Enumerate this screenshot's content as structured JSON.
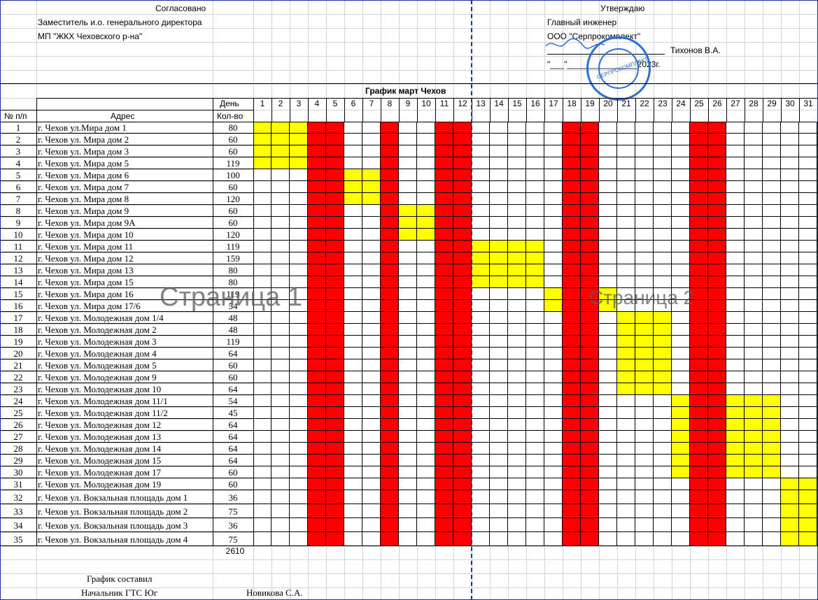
{
  "header": {
    "agreed_title": "Согласовано",
    "agreed_position": "Заместитель и.о. генерального директора",
    "agreed_org": "МП \"ЖКХ Чеховского р-на\"",
    "approve_title": "Утверждаю",
    "approve_position": "Главный инженер",
    "approve_org": "ООО \"Серпрокомплект\"",
    "approve_name": "Тихонов В.А.",
    "approve_date": "\"___\"_______________2023г.",
    "stamp_text": "СЕРПРОКОМПЛЕКТ"
  },
  "schedule_title": "График март Чехов",
  "columns": {
    "num": "№ п/п",
    "address": "Адрес",
    "day": "День",
    "qty": "Кол-во"
  },
  "days": [
    "1",
    "2",
    "3",
    "4",
    "5",
    "6",
    "7",
    "8",
    "9",
    "10",
    "11",
    "12",
    "13",
    "14",
    "15",
    "16",
    "17",
    "18",
    "19",
    "20",
    "21",
    "22",
    "23",
    "24",
    "25",
    "26",
    "27",
    "28",
    "29",
    "30",
    "31"
  ],
  "red_days": [
    4,
    5,
    8,
    11,
    12,
    18,
    19,
    25,
    26
  ],
  "rows": [
    {
      "n": "1",
      "addr": "г. Чехов ул.Мира дом 1",
      "qty": "80",
      "yellow": [
        1,
        2,
        3
      ]
    },
    {
      "n": "2",
      "addr": "г. Чехов ул. Мира дом 2",
      "qty": "60",
      "yellow": [
        1,
        2,
        3
      ]
    },
    {
      "n": "3",
      "addr": "г. Чехов ул. Мира дом 3",
      "qty": "60",
      "yellow": [
        1,
        2,
        3
      ]
    },
    {
      "n": "4",
      "addr": "г. Чехов ул. Мира дом 5",
      "qty": "119",
      "yellow": [
        1,
        2,
        3
      ]
    },
    {
      "n": "5",
      "addr": "г. Чехов ул. Мира дом 6",
      "qty": "100",
      "yellow": [
        6,
        7
      ]
    },
    {
      "n": "6",
      "addr": "г. Чехов ул. Мира дом 7",
      "qty": "60",
      "yellow": [
        6,
        7
      ]
    },
    {
      "n": "7",
      "addr": "г. Чехов ул. Мира дом 8",
      "qty": "120",
      "yellow": [
        6,
        7
      ]
    },
    {
      "n": "8",
      "addr": "г. Чехов ул. Мира дом 9",
      "qty": "60",
      "yellow": [
        9,
        10
      ]
    },
    {
      "n": "9",
      "addr": "г. Чехов ул. Мира дом 9А",
      "qty": "60",
      "yellow": [
        9,
        10
      ]
    },
    {
      "n": "10",
      "addr": "г. Чехов ул. Мира дом 10",
      "qty": "120",
      "yellow": [
        9,
        10
      ]
    },
    {
      "n": "11",
      "addr": "г. Чехов ул. Мира дом 11",
      "qty": "119",
      "yellow": [
        13,
        14,
        15,
        16
      ]
    },
    {
      "n": "12",
      "addr": "г. Чехов ул. Мира дом 12",
      "qty": "159",
      "yellow": [
        13,
        14,
        15,
        16
      ]
    },
    {
      "n": "13",
      "addr": "г. Чехов ул. Мира дом 13",
      "qty": "80",
      "yellow": [
        13,
        14,
        15,
        16
      ]
    },
    {
      "n": "14",
      "addr": "г. Чехов ул. Мира дом 15",
      "qty": "80",
      "yellow": [
        13,
        14,
        15,
        16
      ]
    },
    {
      "n": "15",
      "addr": "г. Чехов ул. Мира дом 16",
      "qty": "119",
      "yellow": [
        17,
        20
      ]
    },
    {
      "n": "16",
      "addr": "г. Чехов ул. Мира дом 17/6",
      "qty": "54",
      "yellow": [
        17,
        20
      ]
    },
    {
      "n": "17",
      "addr": "г. Чехов ул. Молодежная дом 1/4",
      "qty": "48",
      "yellow": [
        21,
        22,
        23
      ]
    },
    {
      "n": "18",
      "addr": "г. Чехов ул. Молодежная дом 2",
      "qty": "48",
      "yellow": [
        21,
        22,
        23
      ]
    },
    {
      "n": "19",
      "addr": "г. Чехов ул. Молодежная дом 3",
      "qty": "119",
      "yellow": [
        21,
        22,
        23
      ]
    },
    {
      "n": "20",
      "addr": "г. Чехов ул. Молодежная дом 4",
      "qty": "64",
      "yellow": [
        21,
        22,
        23
      ]
    },
    {
      "n": "21",
      "addr": "г. Чехов ул. Молодежная дом 5",
      "qty": "60",
      "yellow": [
        21,
        22,
        23
      ]
    },
    {
      "n": "22",
      "addr": "г. Чехов ул. Молодежная дом 9",
      "qty": "60",
      "yellow": [
        21,
        22,
        23
      ]
    },
    {
      "n": "23",
      "addr": "г. Чехов ул. Молодежная дом 10",
      "qty": "64",
      "yellow": [
        21,
        22,
        23
      ]
    },
    {
      "n": "24",
      "addr": "г. Чехов ул. Молодежная дом 11/1",
      "qty": "54",
      "yellow": [
        24,
        27,
        28,
        29
      ]
    },
    {
      "n": "25",
      "addr": "г. Чехов ул. Молодежная дом 11/2",
      "qty": "45",
      "yellow": [
        24,
        27,
        28,
        29
      ]
    },
    {
      "n": "26",
      "addr": "г. Чехов ул. Молодежная дом 12",
      "qty": "64",
      "yellow": [
        24,
        27,
        28,
        29
      ]
    },
    {
      "n": "27",
      "addr": "г. Чехов ул. Молодежная дом 13",
      "qty": "64",
      "yellow": [
        24,
        27,
        28,
        29
      ]
    },
    {
      "n": "28",
      "addr": "г. Чехов ул. Молодежная дом 14",
      "qty": "64",
      "yellow": [
        24,
        27,
        28,
        29
      ]
    },
    {
      "n": "29",
      "addr": "г. Чехов ул. Молодежная дом 15",
      "qty": "64",
      "yellow": [
        24,
        27,
        28,
        29
      ]
    },
    {
      "n": "30",
      "addr": "г. Чехов ул. Молодежная дом 17",
      "qty": "60",
      "yellow": [
        24,
        27,
        28,
        29
      ]
    },
    {
      "n": "31",
      "addr": "г. Чехов ул. Молодежная дом 19",
      "qty": "60",
      "yellow": [
        30,
        31
      ]
    },
    {
      "n": "32",
      "addr": "г. Чехов ул. Вокзальная площадь дом 1",
      "qty": "36",
      "yellow": [
        30,
        31
      ]
    },
    {
      "n": "33",
      "addr": "г. Чехов ул. Вокзальная площадь дом 2",
      "qty": "75",
      "yellow": [
        30,
        31
      ]
    },
    {
      "n": "34",
      "addr": "г. Чехов ул. Вокзальная площадь дом 3",
      "qty": "36",
      "yellow": [
        30,
        31
      ]
    },
    {
      "n": "35",
      "addr": "г. Чехов ул. Вокзальная площадь дом 4",
      "qty": "75",
      "yellow": [
        30,
        31
      ]
    }
  ],
  "total": "2610",
  "footer": {
    "compiled": "График составил",
    "position": "Начальник ГТС Юг",
    "name": "Новикова С.А."
  },
  "watermarks": {
    "page1": "Страница 1",
    "page2": "Страница 2"
  },
  "colors": {
    "red": "#ff0000",
    "yellow": "#ffff00",
    "grid": "#d4d4d4",
    "border": "#000000",
    "page_break": "#1f2f9e"
  }
}
